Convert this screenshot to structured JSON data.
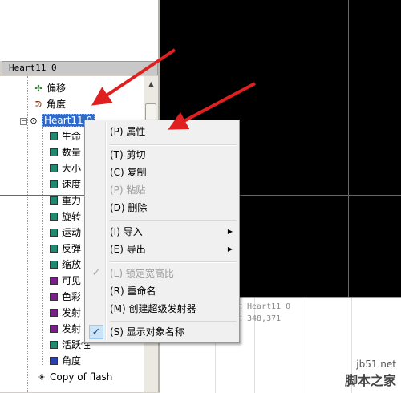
{
  "panel_header": "Heart11 0",
  "tree": {
    "items": [
      {
        "label": "偏移",
        "icon": "offset-icon"
      },
      {
        "label": "角度",
        "icon": "angle-icon"
      },
      {
        "label": "Heart11 0",
        "icon": "emitter-icon"
      },
      {
        "label": "生命",
        "color": "#1f8a70"
      },
      {
        "label": "数量",
        "color": "#1f8a70"
      },
      {
        "label": "大小",
        "color": "#1f8a70"
      },
      {
        "label": "速度",
        "color": "#1f8a70"
      },
      {
        "label": "重力",
        "color": "#1f8a70"
      },
      {
        "label": "旋转",
        "color": "#1f8a70"
      },
      {
        "label": "运动",
        "color": "#1f8a70"
      },
      {
        "label": "反弹",
        "color": "#1f8a70"
      },
      {
        "label": "缩放",
        "color": "#1f8a70"
      },
      {
        "label": "可见",
        "color": "#7a1f8a"
      },
      {
        "label": "色彩",
        "color": "#7a1f8a"
      },
      {
        "label": "发射",
        "color": "#7a1f8a"
      },
      {
        "label": "发射",
        "color": "#7a1f8a"
      },
      {
        "label": "活跃性",
        "color": "#1f8a70"
      },
      {
        "label": "角度",
        "color": "#2a3fb0"
      },
      {
        "label": "Copy of flash",
        "icon": "star-icon"
      }
    ],
    "expand_minus": "−"
  },
  "menu": {
    "items": [
      {
        "label": "(P) 属性",
        "enabled": true
      },
      {
        "label": "(T) 剪切",
        "enabled": true
      },
      {
        "label": "(C) 复制",
        "enabled": true
      },
      {
        "label": "(P) 粘贴",
        "enabled": false
      },
      {
        "label": "(D) 删除",
        "enabled": true
      },
      {
        "label": "(I) 导入",
        "enabled": true,
        "submenu": true
      },
      {
        "label": "(E) 导出",
        "enabled": true,
        "submenu": true
      },
      {
        "label": "(L) 锁定宽高比",
        "enabled": false,
        "checked": true
      },
      {
        "label": "(R) 重命名",
        "enabled": true
      },
      {
        "label": "(M) 创建超级发射器",
        "enabled": true
      },
      {
        "label": "(S) 显示对象名称",
        "enabled": true,
        "checked": true
      }
    ],
    "submenu_arrow": "▶",
    "check_mark": "✓"
  },
  "status": {
    "line1": "：Heart11 0",
    "line2": "：348,371"
  },
  "watermark": {
    "url": "jb51.net",
    "brand": "脚本之家"
  },
  "colors": {
    "annotation_arrow": "#e02020",
    "selection": "#316ac5",
    "crosshair": "#d23a3a"
  }
}
